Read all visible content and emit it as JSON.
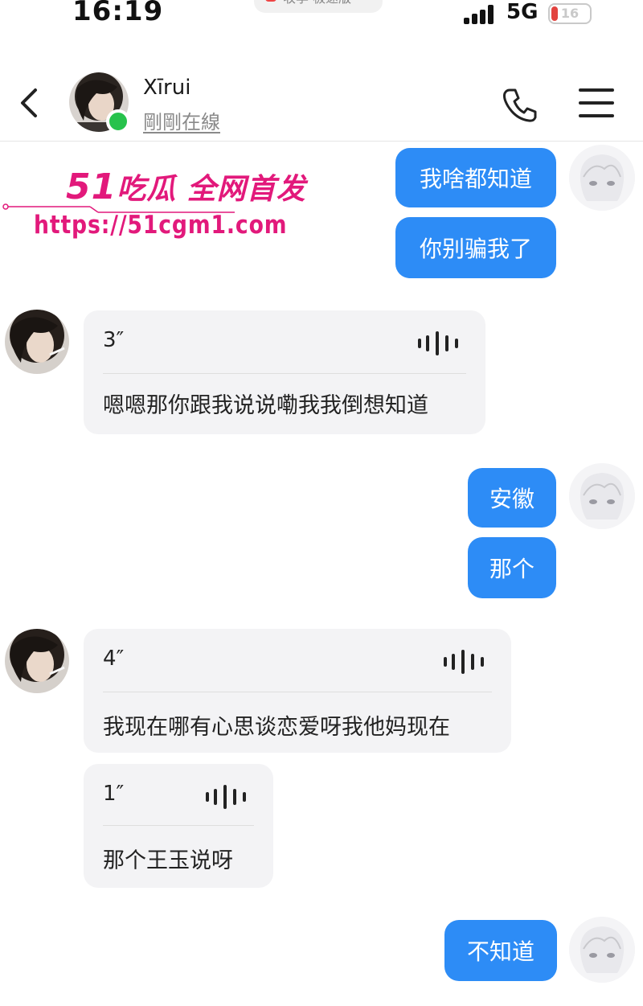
{
  "status_bar": {
    "time": "16:19",
    "island_text": "收李 极速版",
    "network": "5G",
    "battery": "16",
    "battery_level": 0.16
  },
  "header": {
    "contact_name": "Xīrui",
    "contact_status": "剛剛在線"
  },
  "watermark": {
    "line1_big": "51",
    "line1_rest": "吃瓜 全网首发",
    "url": "https://51cgm1.com"
  },
  "messages": {
    "m1": {
      "text": "我啥都知道"
    },
    "m2": {
      "text": "你别骗我了"
    },
    "v1": {
      "duration": "3″",
      "transcript": "嗯嗯那你跟我说说嘞我我倒想知道"
    },
    "m3": {
      "text": "安徽"
    },
    "m4": {
      "text": "那个"
    },
    "v2": {
      "duration": "4″",
      "transcript": "我现在哪有心思谈恋爱呀我他妈现在"
    },
    "v3": {
      "duration": "1″",
      "transcript": "那个王玉说呀"
    },
    "m5": {
      "text": "不知道"
    }
  },
  "colors": {
    "accent": "#2d8cf6",
    "online": "#27c24c",
    "watermark": "#e2197b",
    "received_bubble": "#f3f3f5"
  },
  "icons": [
    "back-icon",
    "phone-icon",
    "menu-icon",
    "voice-wave-icon"
  ]
}
